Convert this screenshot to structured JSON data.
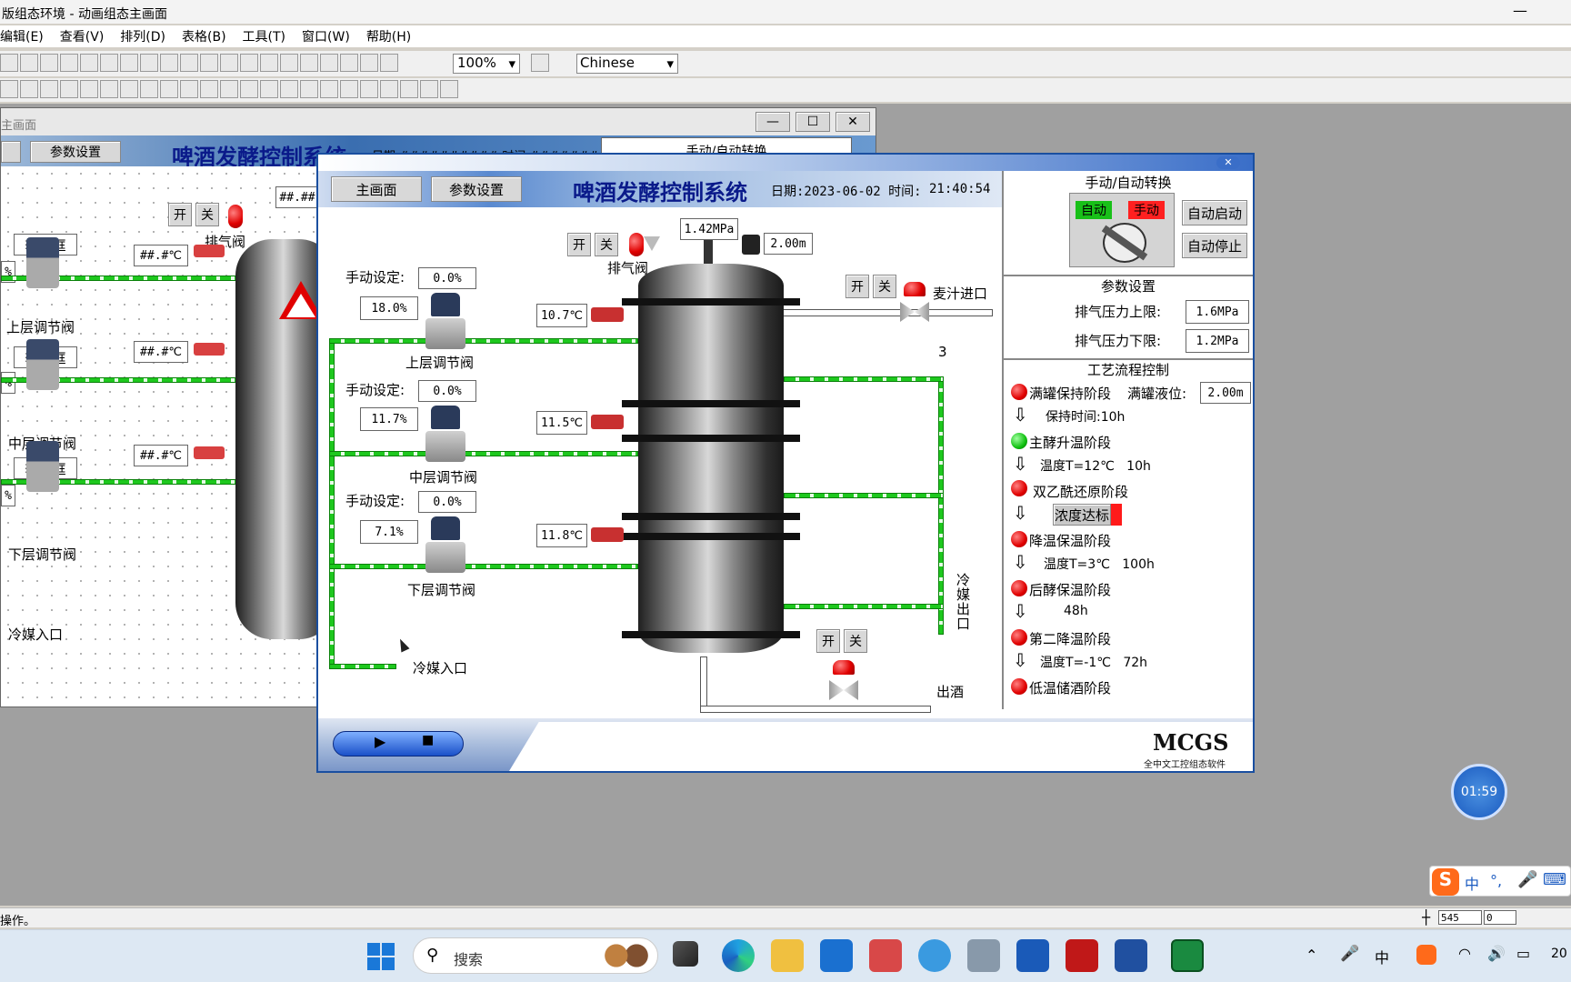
{
  "window": {
    "title": "版组态环境 - 动画组态主画面"
  },
  "menu": [
    "编辑(E)",
    "查看(V)",
    "排列(D)",
    "表格(B)",
    "工具(T)",
    "窗口(W)",
    "帮助(H)"
  ],
  "toolbar": {
    "zoom": "100%",
    "language": "Chinese"
  },
  "bg_window": {
    "title": "主画面",
    "btn_params": "参数设置",
    "header": "啤酒发酵控制系统",
    "date_text": "日期 ########## 时间 ##########",
    "manual_auto": "手动/自动转换",
    "temp_placeholder": "##.#℃",
    "pressure_placeholder": "##.##",
    "input_box": "输入框",
    "valve_top": "上层调节阀",
    "valve_mid": "中层调节阀",
    "valve_bot": "下层调节阀",
    "exhaust": "排气阀",
    "coolant_in": "冷媒入口",
    "open": "开",
    "close": "关",
    "pct": "%"
  },
  "run": {
    "btn_main": "主画面",
    "btn_params": "参数设置",
    "title": "啤酒发酵控制系统",
    "date_label": "日期:2023-06-02 时间:",
    "time": "21:40:54",
    "pressure": "1.42MPa",
    "level": "2.00m",
    "exhaust_label": "排气阀",
    "wort_label": "麦汁进口",
    "open": "开",
    "close": "关",
    "stage_num": "3",
    "manual_label": "手动设定:",
    "layers": [
      {
        "setpoint": "0.0%",
        "output": "18.0%",
        "temp": "10.7℃",
        "valve": "上层调节阀"
      },
      {
        "setpoint": "0.0%",
        "output": "11.7%",
        "temp": "11.5℃",
        "valve": "中层调节阀"
      },
      {
        "setpoint": "0.0%",
        "output": "7.1%",
        "temp": "11.8℃",
        "valve": "下层调节阀"
      }
    ],
    "coolant_in": "冷媒入口",
    "coolant_out": "冷媒出口",
    "beer_out": "出酒",
    "panel": {
      "manual_auto_title": "手动/自动转换",
      "auto": "自动",
      "manual": "手动",
      "auto_start": "自动启动",
      "auto_stop": "自动停止",
      "params_title": "参数设置",
      "p_high_label": "排气压力上限:",
      "p_high": "1.6MPa",
      "p_low_label": "排气压力下限:",
      "p_low": "1.2MPa",
      "process_title": "工艺流程控制",
      "stages": [
        {
          "name": "满罐保持阶段",
          "status": "red",
          "extra_label": "满罐液位:",
          "extra_value": "2.00m",
          "detail": "保持时间:10h"
        },
        {
          "name": "主酵升温阶段",
          "status": "green",
          "detail": "温度T=12℃   10h"
        },
        {
          "name": "双乙酰还原阶段",
          "status": "red",
          "detail": "浓度达标"
        },
        {
          "name": "降温保温阶段",
          "status": "red",
          "detail": "温度T=3℃   100h"
        },
        {
          "name": "后酵保温阶段",
          "status": "red",
          "detail": "48h"
        },
        {
          "name": "第二降温阶段",
          "status": "red",
          "detail": "温度T=-1℃   72h"
        },
        {
          "name": "低温储酒阶段",
          "status": "red"
        }
      ]
    },
    "brand": "MCGS",
    "brand_sub": "全中文工控组态软件"
  },
  "timer": "01:59",
  "status": {
    "text": "操作。",
    "x": "545",
    "y": "0"
  },
  "taskbar": {
    "search": "搜索",
    "ime": "中",
    "year": "20"
  }
}
